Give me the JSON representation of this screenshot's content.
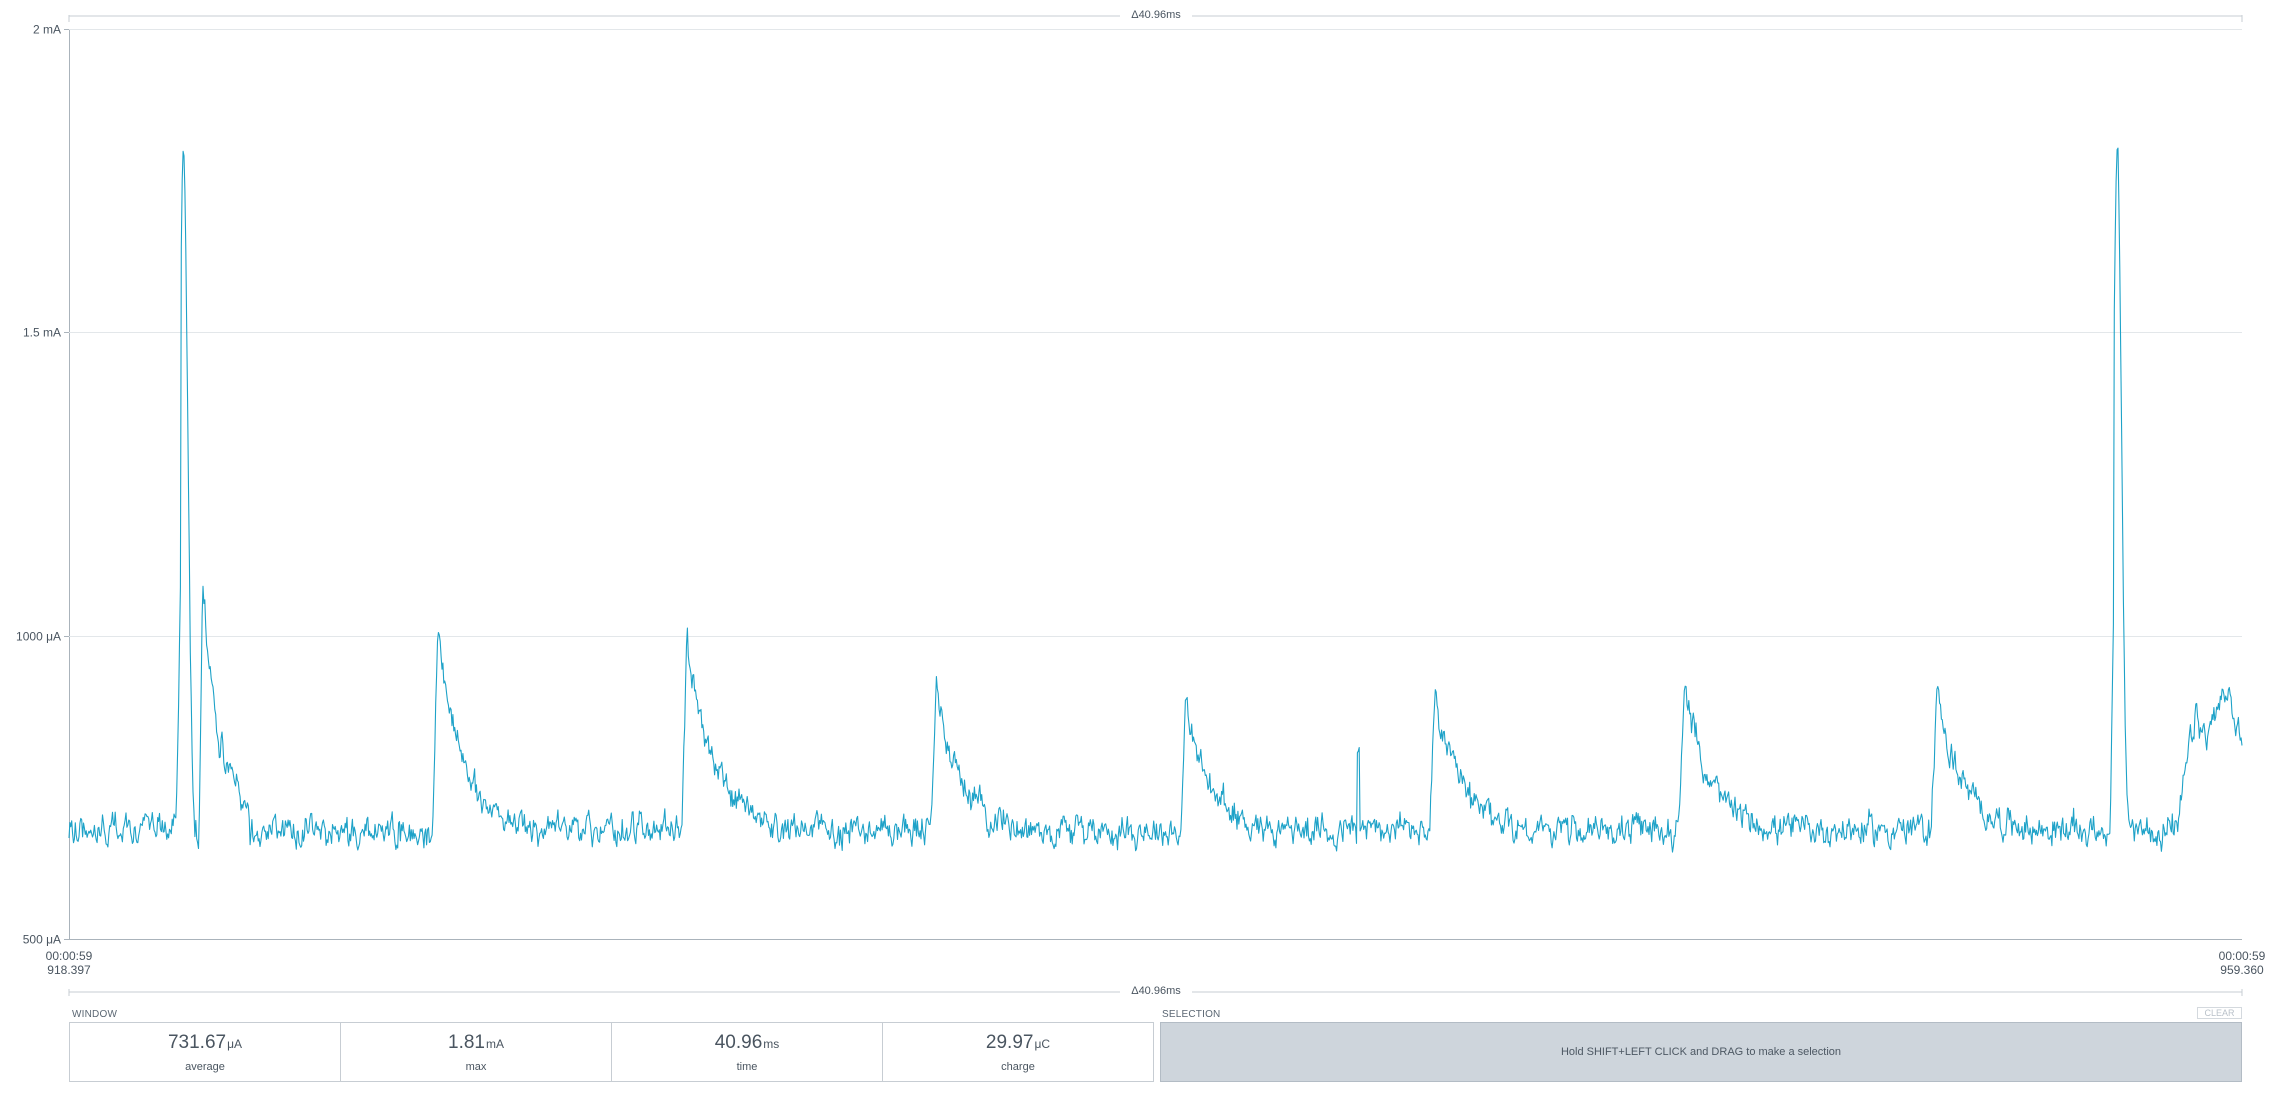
{
  "chart_data": {
    "type": "line",
    "title": "",
    "xlabel": "",
    "ylabel": "",
    "ylim_uA": [
      500,
      2000
    ],
    "y_tick_values_uA": [
      500,
      1000,
      1500,
      2000
    ],
    "y_tick_labels": [
      "500 μA",
      "1000 μA",
      "1.5 mA",
      "2 mA"
    ],
    "x_start_label": [
      "00:00:59",
      "918.397"
    ],
    "x_end_label": [
      "00:00:59",
      "959.360"
    ],
    "xlim_ms": [
      0,
      40.96
    ],
    "grid": true,
    "line_color": "#1ea2c8",
    "baseline_uA": 680,
    "noise_uA": 20,
    "series": [
      {
        "name": "",
        "events": [
          {
            "kind": "spike",
            "t_ms": 2.1,
            "peak_uA": 1810,
            "secondary_uA": 1070
          },
          {
            "kind": "hump",
            "t_ms": 6.85,
            "peak_uA": 1010
          },
          {
            "kind": "hump",
            "t_ms": 11.55,
            "peak_uA": 1005
          },
          {
            "kind": "hump",
            "t_ms": 16.25,
            "peak_uA": 920
          },
          {
            "kind": "hump",
            "t_ms": 20.95,
            "peak_uA": 880
          },
          {
            "kind": "glitch",
            "t_ms": 24.3,
            "peak_uA": 810
          },
          {
            "kind": "hump",
            "t_ms": 25.65,
            "peak_uA": 900
          },
          {
            "kind": "hump",
            "t_ms": 30.35,
            "peak_uA": 920
          },
          {
            "kind": "hump",
            "t_ms": 35.1,
            "peak_uA": 910
          },
          {
            "kind": "spike",
            "t_ms": 38.55,
            "peak_uA": 1780,
            "secondary_uA": 0
          },
          {
            "kind": "tail",
            "t_ms": 39.75,
            "peak_uA": 900
          }
        ]
      }
    ]
  },
  "top_delta_label": "Δ40.96ms",
  "bottom_delta_label": "Δ40.96ms",
  "window": {
    "title": "WINDOW",
    "stats": [
      {
        "value": "731.67",
        "unit": "μA",
        "label": "average"
      },
      {
        "value": "1.81",
        "unit": "mA",
        "label": "max"
      },
      {
        "value": "40.96",
        "unit": "ms",
        "label": "time"
      },
      {
        "value": "29.97",
        "unit": "μC",
        "label": "charge"
      }
    ]
  },
  "selection": {
    "title": "SELECTION",
    "clear_label": "CLEAR",
    "hint": "Hold SHIFT+LEFT CLICK and DRAG to make a selection"
  }
}
